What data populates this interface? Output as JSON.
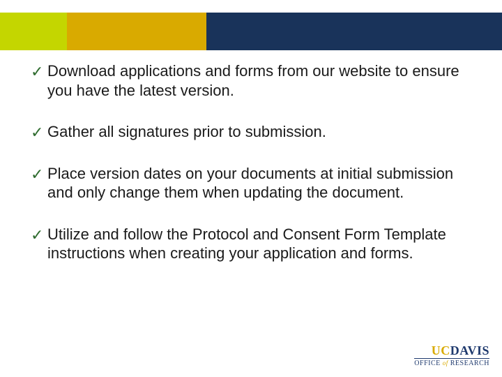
{
  "colors": {
    "lime": "#c4d600",
    "gold": "#d9aa00",
    "navy": "#19335a",
    "check": "#2e6b2e"
  },
  "bullets": [
    "Download applications and forms from our website to ensure you have the latest version.",
    "Gather all signatures prior to submission.",
    "Place version dates on your documents at initial submission and only change them when updating the document.",
    "Utilize and follow the Protocol and Consent Form Template instructions when creating your application and forms."
  ],
  "check_glyph": "✓",
  "logo": {
    "part1": "UC",
    "part2": "DAVIS",
    "sub_left": "OFFICE",
    "sub_of": "of",
    "sub_right": "RESEARCH"
  }
}
